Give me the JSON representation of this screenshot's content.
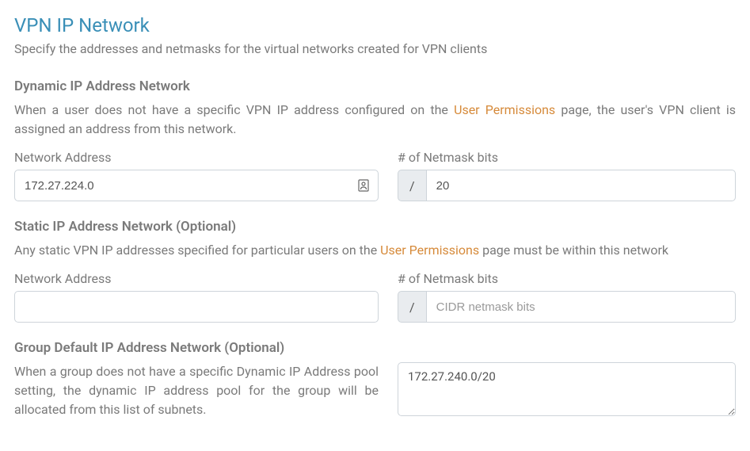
{
  "header": {
    "title": "VPN IP Network",
    "subtitle": "Specify the addresses and netmasks for the virtual networks created for VPN clients"
  },
  "dynamic": {
    "title": "Dynamic IP Address Network",
    "desc_before": "When a user does not have a specific VPN IP address configured on the ",
    "link_text": "User Permissions",
    "desc_after": " page, the user's VPN client is assigned an address from this network.",
    "network_label": "Network Address",
    "network_value": "172.27.224.0",
    "netmask_label": "# of Netmask bits",
    "netmask_prefix": "/",
    "netmask_value": "20"
  },
  "static": {
    "title": "Static IP Address Network (Optional)",
    "desc_before": "Any static VPN IP addresses specified for particular users on the ",
    "link_text": "User Permissions",
    "desc_after": " page must be within this network",
    "network_label": "Network Address",
    "network_value": "",
    "netmask_label": "# of Netmask bits",
    "netmask_prefix": "/",
    "netmask_value": "",
    "netmask_placeholder": "CIDR netmask bits"
  },
  "group": {
    "title": "Group Default IP Address Network (Optional)",
    "desc": "When a group does not have a specific Dynamic IP Address pool setting, the dynamic IP address pool for the group will be allocated from this list of subnets.",
    "subnets_value": "172.27.240.0/20"
  }
}
